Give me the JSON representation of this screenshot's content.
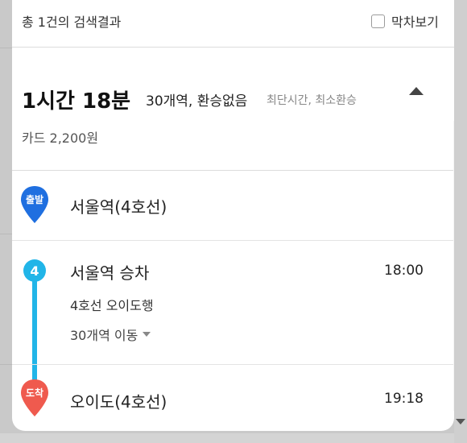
{
  "header": {
    "result_count": "총 1건의 검색결과",
    "last_train_label": "막차보기"
  },
  "summary": {
    "duration": "1시간 18분",
    "stations_info": "30개역, 환승없음",
    "route_tags": "최단시간, 최소환승",
    "fare": "카드 2,200원"
  },
  "steps": {
    "depart": {
      "badge": "출발",
      "name": "서울역(4호선)",
      "badge_color": "#1f6fe0"
    },
    "board": {
      "line_number": "4",
      "name": "서울역 승차",
      "time": "18:00",
      "direction": "4호선 오이도행",
      "stops": "30개역 이동",
      "line_color": "#21b5e8"
    },
    "arrive": {
      "badge": "도착",
      "name": "오이도(4호선)",
      "time": "19:18",
      "badge_color": "#ef5a4e"
    }
  }
}
